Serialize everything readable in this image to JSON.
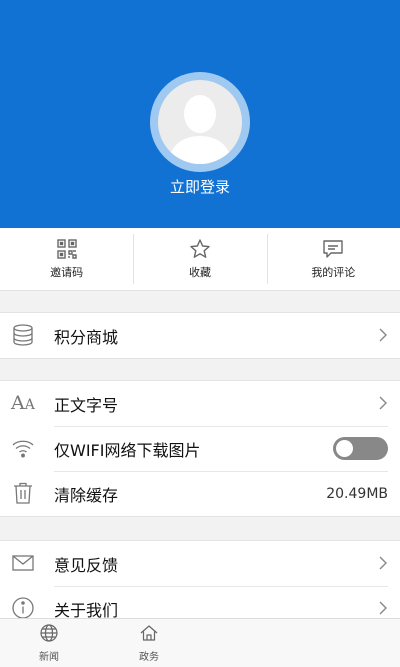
{
  "header": {
    "login_label": "立即登录"
  },
  "quick_actions": [
    {
      "label": "邀请码",
      "icon": "qr-code-icon"
    },
    {
      "label": "收藏",
      "icon": "star-icon"
    },
    {
      "label": "我的评论",
      "icon": "comment-icon"
    }
  ],
  "menu": {
    "points_mall": "积分商城",
    "font_size": "正文字号",
    "wifi_only_images": "仅WIFI网络下载图片",
    "wifi_toggle_state": "off",
    "clear_cache": "清除缓存",
    "cache_size": "20.49MB",
    "feedback": "意见反馈",
    "about": "关于我们"
  },
  "tabbar": {
    "items": [
      {
        "label": "新闻",
        "icon": "globe-icon"
      },
      {
        "label": "政务",
        "icon": "home-icon"
      }
    ]
  },
  "colors": {
    "header_blue": "#1172d3",
    "toggle_off": "#888888"
  }
}
